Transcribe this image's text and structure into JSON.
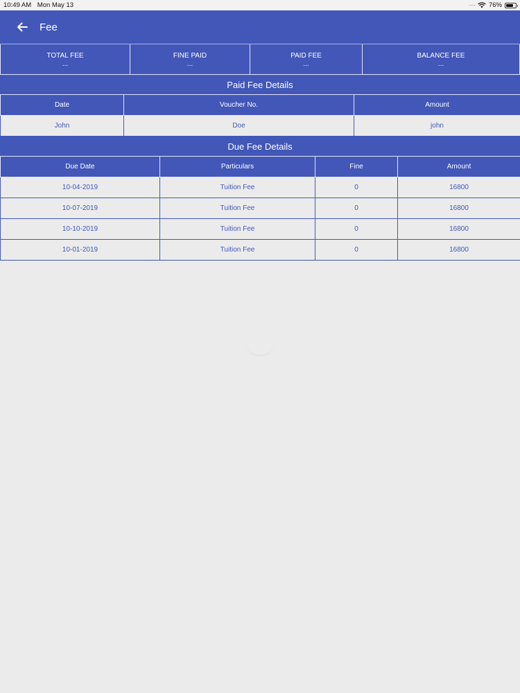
{
  "status_bar": {
    "time": "10:49 AM",
    "date": "Mon May 13",
    "signal": "····",
    "battery_percent": "76%",
    "battery_level": 0.76
  },
  "app_bar": {
    "title": "Fee",
    "back_icon": "arrow-left-icon"
  },
  "summary": [
    {
      "label": "TOTAL FEE",
      "value": "..."
    },
    {
      "label": "FINE PAID",
      "value": "..."
    },
    {
      "label": "PAID FEE",
      "value": "..."
    },
    {
      "label": "BALANCE FEE",
      "value": "..."
    }
  ],
  "paid_fee": {
    "title": "Paid Fee Details",
    "headers": [
      "Date",
      "Voucher No.",
      "Amount"
    ],
    "rows": [
      [
        "John",
        "Doe",
        "john"
      ]
    ]
  },
  "due_fee": {
    "title": "Due Fee Details",
    "headers": [
      "Due Date",
      "Particulars",
      "Fine",
      "Amount"
    ],
    "rows": [
      [
        "10-04-2019",
        "Tuition Fee",
        "0",
        "16800"
      ],
      [
        "10-07-2019",
        "Tuition Fee",
        "0",
        "16800"
      ],
      [
        "10-10-2019",
        "Tuition Fee",
        "0",
        "16800"
      ],
      [
        "10-01-2019",
        "Tuition Fee",
        "0",
        "16800"
      ]
    ]
  },
  "colors": {
    "primary": "#4257b8",
    "background": "#ebebeb"
  }
}
